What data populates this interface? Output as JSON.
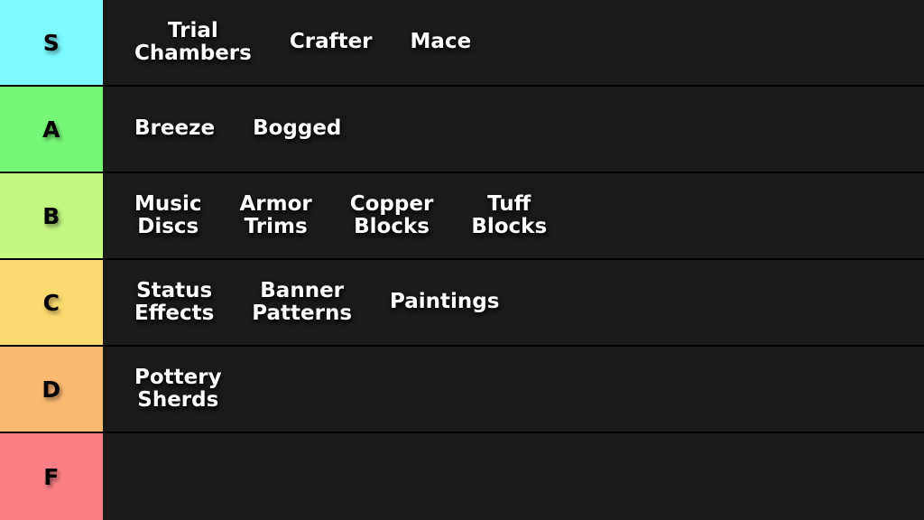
{
  "tiers": [
    {
      "label": "S",
      "color": "#7df9ff",
      "items": [
        "Trial\nChambers",
        "Crafter",
        "Mace"
      ]
    },
    {
      "label": "A",
      "color": "#77f777",
      "items": [
        "Breeze",
        "Bogged"
      ]
    },
    {
      "label": "B",
      "color": "#c4f782",
      "items": [
        "Music\nDiscs",
        "Armor\nTrims",
        "Copper\nBlocks",
        "Tuff\nBlocks"
      ]
    },
    {
      "label": "C",
      "color": "#fad971",
      "items": [
        "Status\nEffects",
        "Banner\nPatterns",
        "Paintings"
      ]
    },
    {
      "label": "D",
      "color": "#fbb972",
      "items": [
        "Pottery\nSherds"
      ]
    },
    {
      "label": "F",
      "color": "#fa8086",
      "items": []
    }
  ],
  "theme": {
    "background": "#000000",
    "row_background": "#1a1a18",
    "item_text_color": "#ffffff",
    "tier_label_text_color": "#000000",
    "separator_color": "#000000"
  }
}
